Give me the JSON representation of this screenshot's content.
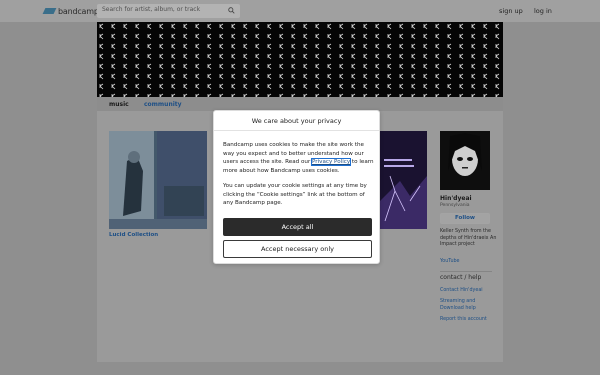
{
  "header": {
    "logo_text": "bandcamp",
    "search_placeholder": "Search for artist, album, or track",
    "signup_label": "sign up",
    "login_label": "log in"
  },
  "nav": {
    "music_label": "music",
    "community_label": "community"
  },
  "albums": [
    {
      "title": "Lucid Collection"
    },
    {
      "title": ""
    }
  ],
  "artist": {
    "name": "Hin'dyeai",
    "location": "Pennsylvania",
    "follow_label": "Follow",
    "bio": "Keller Synth from the depths of Hin'draeix An Impact project",
    "youtube_label": "YouTube",
    "contact_head": "contact / help",
    "contact_link": "Contact Hin'dyeai",
    "streaming_link": "Streaming and Download help",
    "report_link": "Report this account"
  },
  "cookie_modal": {
    "title": "We care about your privacy",
    "text_before_link": "Bandcamp uses cookies to make the site work the way you expect and to better understand how our users access the site. Read our ",
    "policy_link": "Privacy Policy",
    "text_after_link": " to learn more about how Bandcamp uses cookies.",
    "settings_text": "You can update your cookie settings at any time by clicking the “Cookie settings” link at the bottom of any Bandcamp page.",
    "accept_all_label": "Accept all",
    "accept_necessary_label": "Accept necessary only"
  },
  "colors": {
    "link": "#1d4f86",
    "accept_button": "#2b2b2b"
  }
}
